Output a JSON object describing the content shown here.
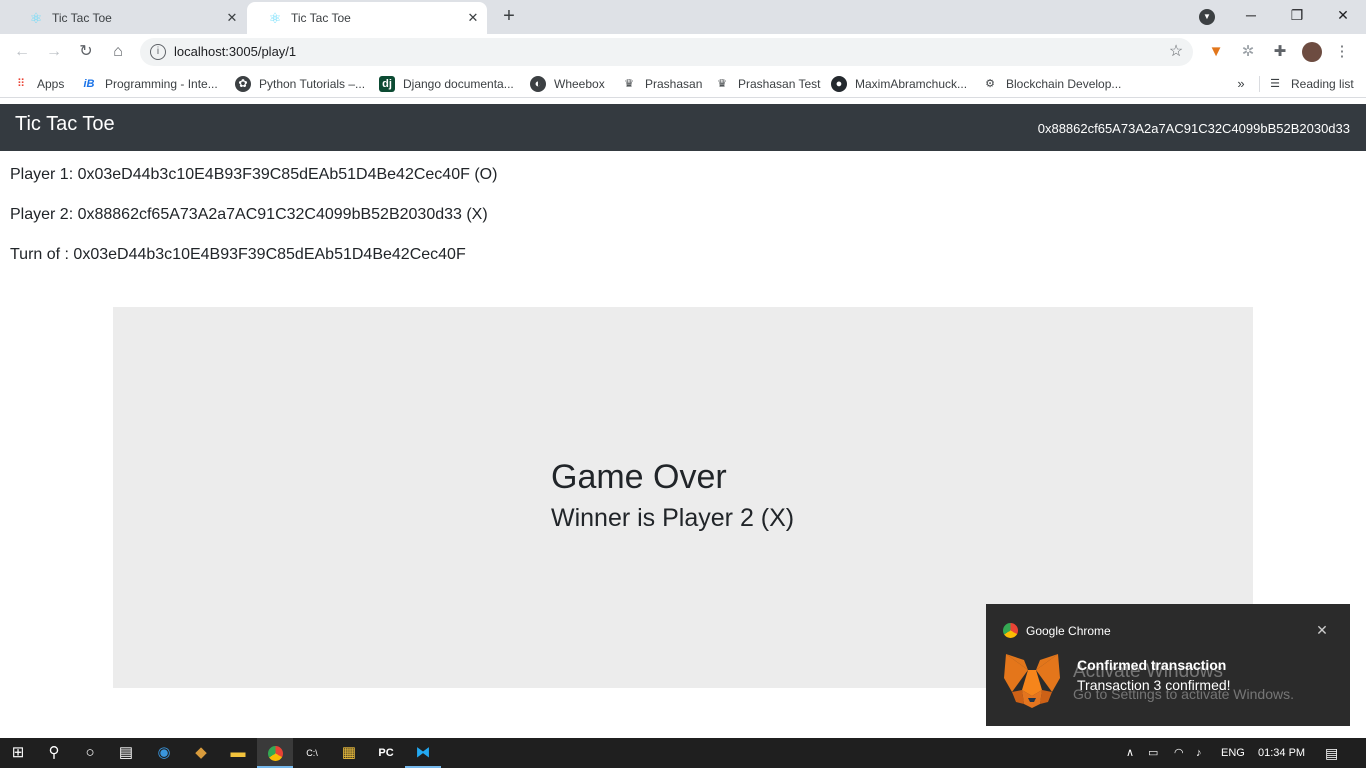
{
  "browser": {
    "tabs": [
      {
        "title": "Tic Tac Toe",
        "active": false
      },
      {
        "title": "Tic Tac Toe",
        "active": true
      }
    ],
    "url": "localhost:3005/play/1",
    "bookmarks": [
      {
        "label": "Apps"
      },
      {
        "label": "Programming - Inte..."
      },
      {
        "label": "Python Tutorials –..."
      },
      {
        "label": "Django documenta..."
      },
      {
        "label": "Wheebox"
      },
      {
        "label": "Prashasan"
      },
      {
        "label": "Prashasan Test"
      },
      {
        "label": "MaximAbramchuck..."
      },
      {
        "label": "Blockchain Develop..."
      }
    ],
    "reading_list": "Reading list"
  },
  "app": {
    "brand": "Tic Tac Toe",
    "account": "0x88862cf65A73A2a7AC91C32C4099bB52B2030d33",
    "player1": "Player 1: 0x03eD44b3c10E4B93F39C85dEAb51D4Be42Cec40F (O)",
    "player2": "Player 2: 0x88862cf65A73A2a7AC91C32C4099bB52B2030d33 (X)",
    "turn": "Turn of : 0x03eD44b3c10E4B93F39C85dEAb51D4Be42Cec40F",
    "game_over": "Game Over",
    "winner": "Winner is Player 2 (X)"
  },
  "notification": {
    "app": "Google Chrome",
    "title": "Confirmed transaction",
    "body": "Transaction 3 confirmed!"
  },
  "watermark": {
    "line1": "Activate Windows",
    "line2": "Go to Settings to activate Windows."
  },
  "taskbar": {
    "language": "ENG",
    "time": "01:34 PM"
  },
  "colors": {
    "navbar": "#343a40",
    "board": "#ececec",
    "tabstrip": "#dee1e6"
  }
}
